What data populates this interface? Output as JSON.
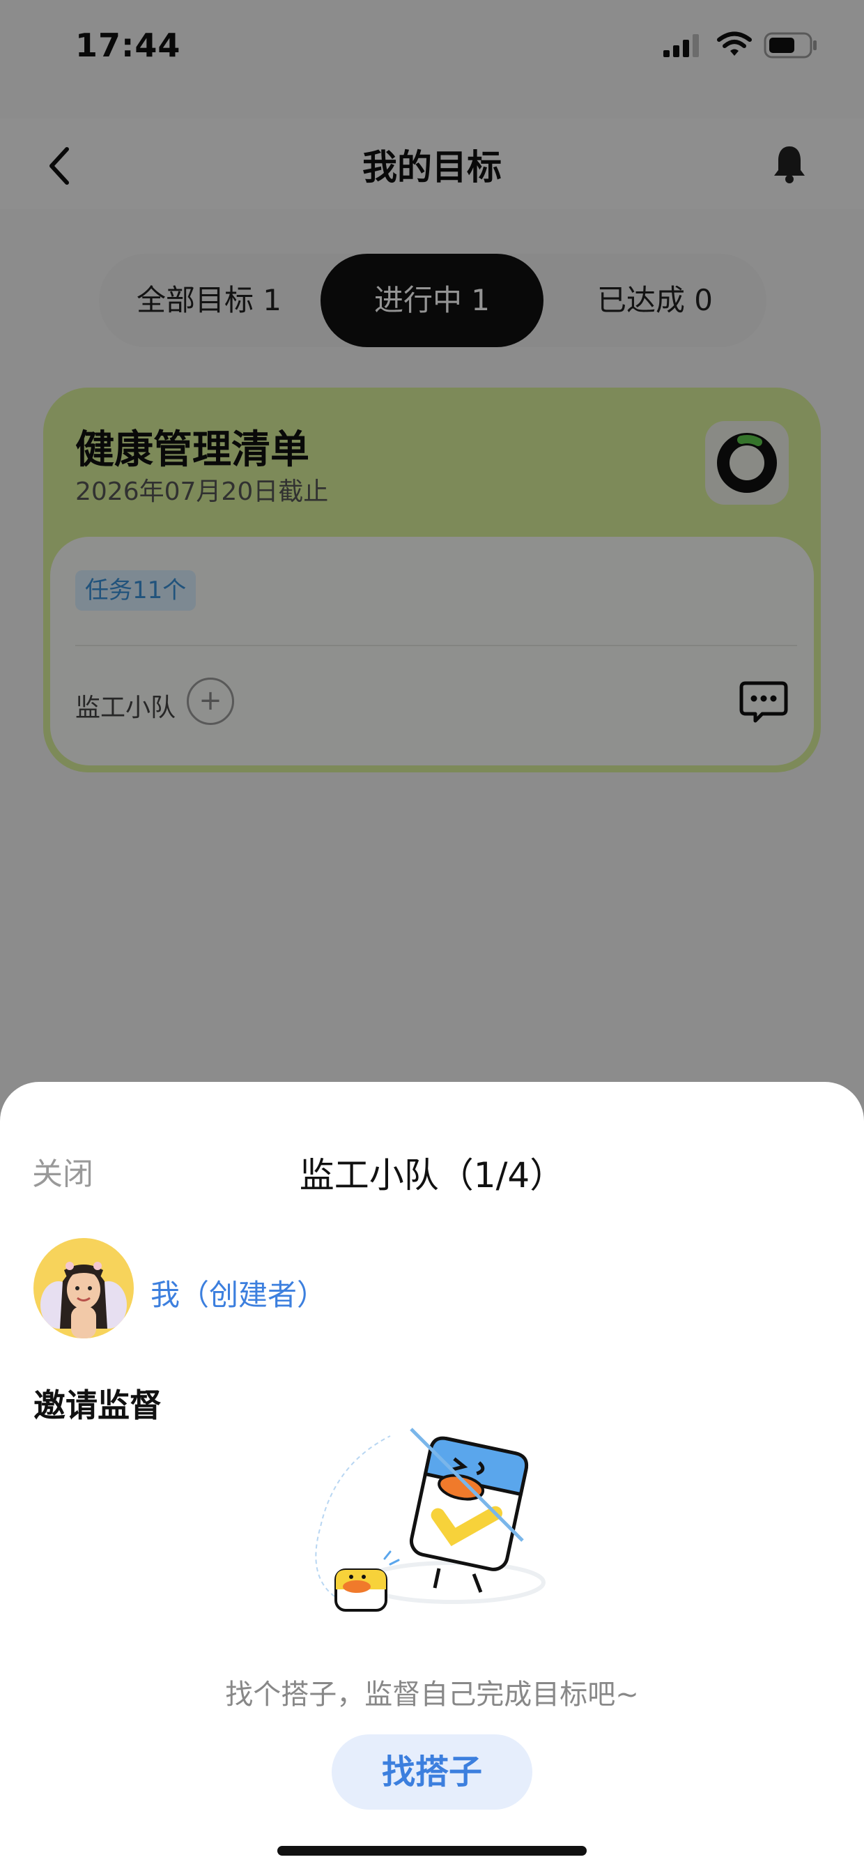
{
  "status_bar": {
    "time": "17:44"
  },
  "nav": {
    "title": "我的目标"
  },
  "tabs": [
    {
      "label": "全部目标 1",
      "active": false
    },
    {
      "label": "进行中 1",
      "active": true
    },
    {
      "label": "已达成 0",
      "active": false
    }
  ],
  "goal_card": {
    "title": "健康管理清单",
    "deadline": "2026年07月20日截止",
    "task_badge": "任务11个",
    "team_label": "监工小队",
    "accent_color": "#d8ee9a"
  },
  "sheet": {
    "close_label": "关闭",
    "title": "监工小队（1/4）",
    "member_label": "我（创建者）",
    "invite_heading": "邀请监督",
    "hint": "找个搭子，监督自己完成目标吧~",
    "find_button": "找搭子",
    "accent_color": "#3c7fde"
  }
}
